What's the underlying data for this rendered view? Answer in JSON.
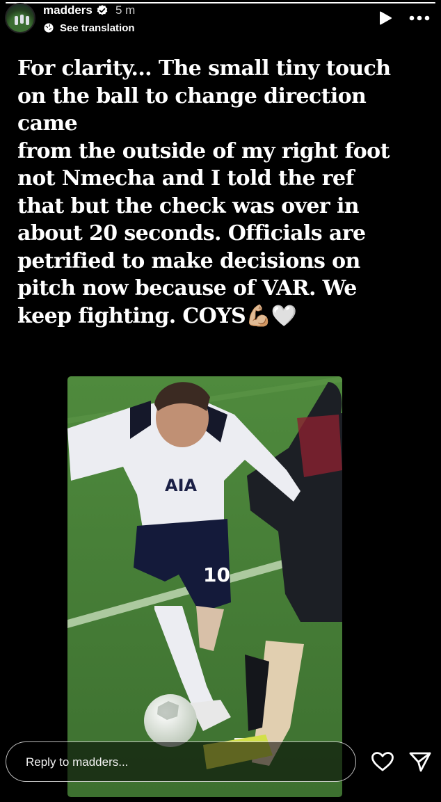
{
  "story": {
    "progress": 1.0,
    "username": "madders",
    "verified": true,
    "time_ago": "5 m",
    "see_translation": "See translation",
    "caption": "For clarity... The small tiny touch\non the ball to change direction\ncame\nfrom the outside of my right foot\nnot Nmecha and I told the ref\nthat but the check was over in\nabout 20 seconds. Officials are\npetrified to make decisions on\npitch now because of VAR. We\nkeep fighting. COYS💪🏼🤍",
    "photo": {
      "icon": "football-photo",
      "shirt_number": "10",
      "shirt_sponsor": "AIA"
    }
  },
  "reply": {
    "placeholder": "Reply to madders..."
  },
  "icons": {
    "play": "play-icon",
    "more": "more-icon",
    "heart": "heart-icon",
    "send": "send-icon",
    "verified": "verified-badge-icon",
    "translate": "globe-icon"
  },
  "colors": {
    "background": "#000000",
    "text": "#ffffff",
    "verified": "#ffffff"
  }
}
